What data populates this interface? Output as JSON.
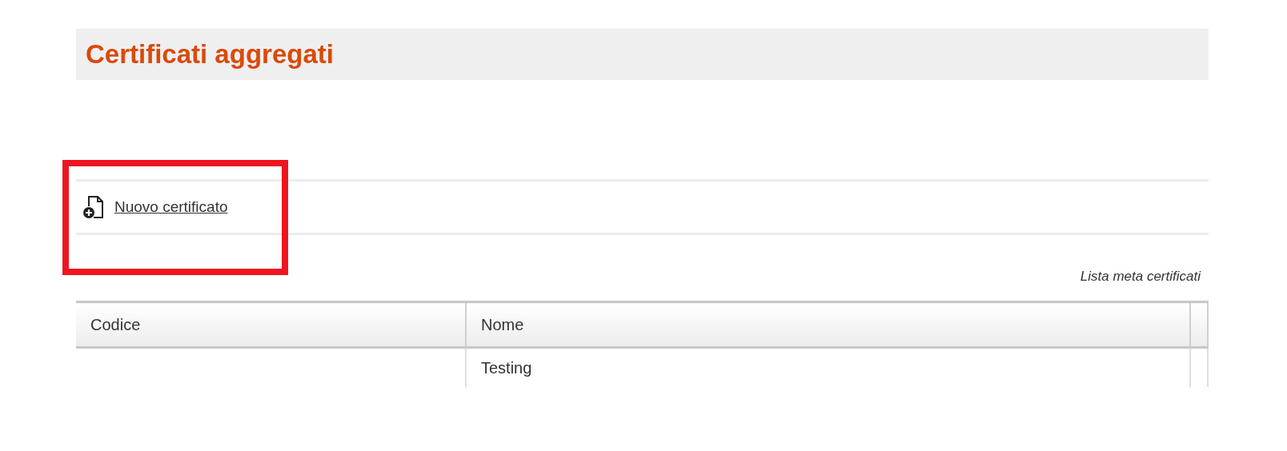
{
  "page_title": "Certificati aggregati",
  "toolbar": {
    "new_link": "Nuovo certificato",
    "highlighted": true
  },
  "table": {
    "caption": "Lista meta certificati",
    "columns": [
      "Codice",
      "Nome"
    ],
    "rows": [
      {
        "cells": [
          "",
          "Testing"
        ]
      }
    ]
  }
}
